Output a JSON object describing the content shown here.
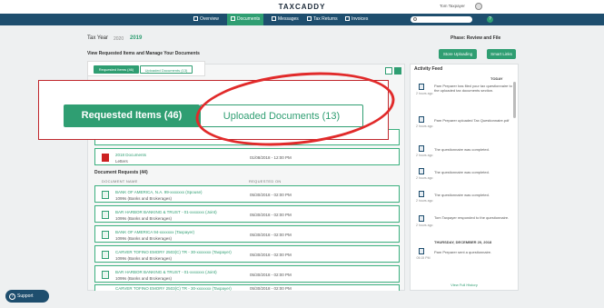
{
  "header": {
    "logo": "TAXCADDY",
    "user_name": "Tom Taxpayer",
    "nav": [
      {
        "label": "Overview",
        "icon": "home-icon"
      },
      {
        "label": "Documents",
        "icon": "document-icon"
      },
      {
        "label": "Messages",
        "icon": "chat-icon"
      },
      {
        "label": "Tax Returns",
        "icon": "folder-icon"
      },
      {
        "label": "Invoices",
        "icon": "invoice-icon"
      }
    ],
    "active_nav": "Documents",
    "help": "?"
  },
  "page": {
    "tax_year_label": "Tax Year",
    "tax_year_prev": "2020",
    "tax_year_current": "2019",
    "phase": "Phase: Review and File",
    "section_title": "View Requested Items and Manage Your Documents",
    "buttons": {
      "store": "Store Uploading",
      "links": "Smart Links"
    }
  },
  "tabs": {
    "requested": "Requested Items (46)",
    "uploaded": "Uploaded Documents (13)"
  },
  "documents": [
    {
      "title": "2018 Documents",
      "subtitle": "Letters",
      "date": "01/08/2018 - 12:00 PM"
    }
  ],
  "requests": {
    "title": "Document Requests (44)",
    "columns": {
      "name": "DOCUMENT NAME",
      "requested": "REQUESTED ON"
    },
    "rows": [
      {
        "title": "BANK OF AMERICA, N.A. 99-xxxxxxx (Spouse)",
        "subtitle": "1099s (Banks and Brokerages)",
        "date": "05/30/2018 - 02:00 PM"
      },
      {
        "title": "BAR HARBOR BANKING & TRUST - 01-xxxxxxx (Joint)",
        "subtitle": "1099s (Banks and Brokerages)",
        "date": "05/30/2018 - 02:00 PM"
      },
      {
        "title": "BANK OF AMERICA 94-xxxxxxx (Taxpayer)",
        "subtitle": "1099s (Banks and Brokerages)",
        "date": "05/30/2018 - 02:00 PM"
      },
      {
        "title": "CARVER TOFINO EMORY 2503(C) TR - 30-xxxxxxx (Taxpayer)",
        "subtitle": "1099s (Banks and Brokerages)",
        "date": "05/30/2018 - 02:00 PM"
      },
      {
        "title": "BAR HARBOR BANKING & TRUST - 01-xxxxxxx (Joint)",
        "subtitle": "1099s (Banks and Brokerages)",
        "date": "05/30/2018 - 02:00 PM"
      },
      {
        "title": "CARVER TOFINO EMORY 2503(C) TR - 30-xxxxxxx (Taxpayer)",
        "subtitle": "",
        "date": "05/30/2018 - 02:00 PM"
      }
    ]
  },
  "activity": {
    "title": "Activity Feed",
    "today": "TODAY",
    "date_separator": "THURSDAY, DECEMBER 20, 2018",
    "items": [
      {
        "time": "2 hours ago",
        "text": "Pam Preparer has filed your tax questionnaire to the uploaded tax documents section."
      },
      {
        "time": "2 hours ago",
        "text": "Pam Preparer uploaded Tax Questionnaire.pdf"
      },
      {
        "time": "2 hours ago",
        "text": "The questionnaire was completed."
      },
      {
        "time": "2 hours ago",
        "text": "The questionnaire was completed."
      },
      {
        "time": "2 hours ago",
        "text": "The questionnaire was completed."
      },
      {
        "time": "2 hours ago",
        "text": "Tom Taxpayer responded to the questionnaire."
      },
      {
        "time": "05:15 PM",
        "text": "Pam Preparer sent a questionnaire."
      }
    ],
    "view_full": "View Full History"
  },
  "support": {
    "label": "Support"
  }
}
